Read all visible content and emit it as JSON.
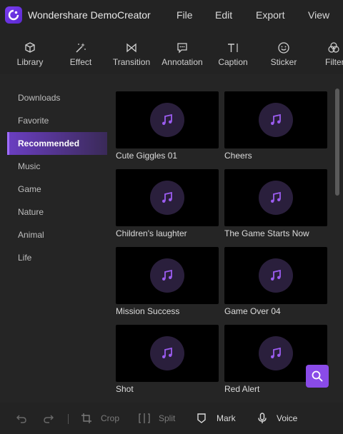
{
  "app": {
    "title": "Wondershare DemoCreator"
  },
  "menu": {
    "file": "File",
    "edit": "Edit",
    "export": "Export",
    "view": "View"
  },
  "toolbar": {
    "library": "Library",
    "effect": "Effect",
    "transition": "Transition",
    "annotation": "Annotation",
    "caption": "Caption",
    "sticker": "Sticker",
    "filter": "Filter"
  },
  "sidebar": {
    "items": [
      {
        "label": "Downloads"
      },
      {
        "label": "Favorite"
      },
      {
        "label": "Recommended"
      },
      {
        "label": "Music"
      },
      {
        "label": "Game"
      },
      {
        "label": "Nature"
      },
      {
        "label": "Animal"
      },
      {
        "label": "Life"
      }
    ],
    "active": "Recommended"
  },
  "sounds": [
    {
      "label": "Cute Giggles 01"
    },
    {
      "label": "Cheers"
    },
    {
      "label": "Children's laughter"
    },
    {
      "label": "The Game Starts Now"
    },
    {
      "label": "Mission Success"
    },
    {
      "label": "Game Over 04"
    },
    {
      "label": "Shot"
    },
    {
      "label": "Red Alert"
    }
  ],
  "bottombar": {
    "crop": "Crop",
    "split": "Split",
    "mark": "Mark",
    "voice": "Voice"
  },
  "colors": {
    "accent": "#8a4be8",
    "active_item": "#6a3ec0",
    "note": "#9b5cf0"
  }
}
